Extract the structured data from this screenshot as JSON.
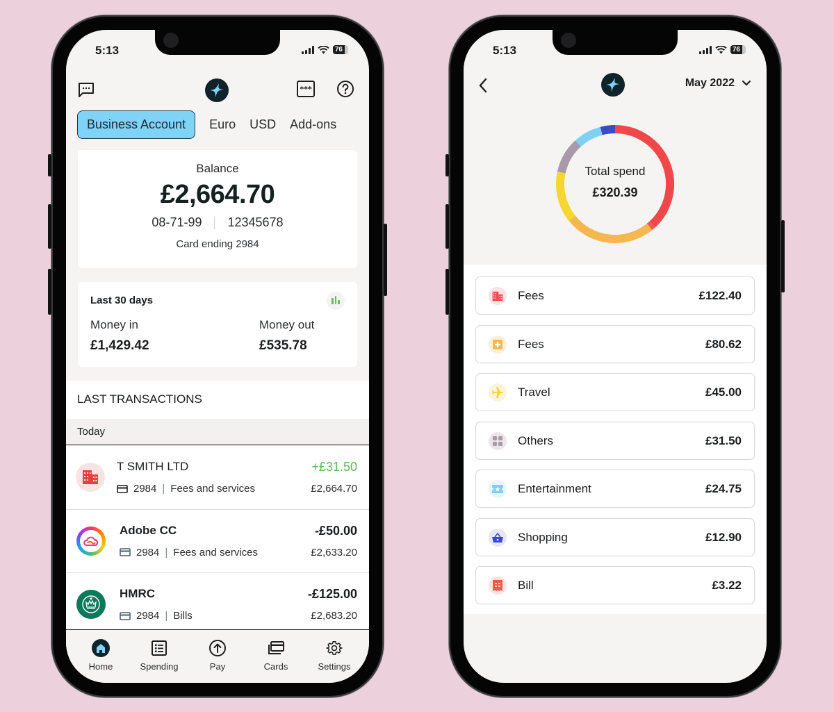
{
  "status_bar": {
    "time": "5:13",
    "battery": "76"
  },
  "home": {
    "tabs": [
      {
        "label": "Business Account",
        "active": true
      },
      {
        "label": "Euro",
        "active": false
      },
      {
        "label": "USD",
        "active": false
      },
      {
        "label": "Add-ons",
        "active": false
      }
    ],
    "balance": {
      "label": "Balance",
      "amount": "£2,664.70",
      "sort_code": "08-71-99",
      "account_number": "12345678",
      "card_ending": "Card ending 2984"
    },
    "period": {
      "title": "Last 30 days",
      "money_in_label": "Money in",
      "money_in": "£1,429.42",
      "money_out_label": "Money out",
      "money_out": "£535.78"
    },
    "transactions_header": "LAST TRANSACTIONS",
    "day_label": "Today",
    "transactions": [
      {
        "name": "T SMITH LTD",
        "card": "2984",
        "category": "Fees and services",
        "amount": "+£31.50",
        "balance": "£2,664.70",
        "icon": "building-icon",
        "positive": true
      },
      {
        "name": "Adobe CC",
        "card": "2984",
        "category": "Fees and services",
        "amount": "-£50.00",
        "balance": "£2,633.20",
        "icon": "adobe-cc-logo",
        "positive": false
      },
      {
        "name": "HMRC",
        "card": "2984",
        "category": "Bills",
        "amount": "-£125.00",
        "balance": "£2,683.20",
        "icon": "hmrc-crown-logo",
        "positive": false
      }
    ],
    "nav": [
      {
        "label": "Home",
        "icon": "home-icon",
        "active": true
      },
      {
        "label": "Spending",
        "icon": "list-icon",
        "active": false
      },
      {
        "label": "Pay",
        "icon": "arrow-up-circle-icon",
        "active": false
      },
      {
        "label": "Cards",
        "icon": "cards-icon",
        "active": false
      },
      {
        "label": "Settings",
        "icon": "gear-icon",
        "active": false
      }
    ]
  },
  "spending": {
    "month": "May 2022",
    "total_label": "Total spend",
    "total": "£320.39",
    "categories": [
      {
        "name": "Fees",
        "amount": "£122.40",
        "icon": "building-icon",
        "color": "#f0474b",
        "bg": "#fbe3e3"
      },
      {
        "name": "Fees",
        "amount": "£80.62",
        "icon": "medical-plus-icon",
        "color": "#f5b84e",
        "bg": "#fdf0d9"
      },
      {
        "name": "Travel",
        "amount": "£45.00",
        "icon": "plane-icon",
        "color": "#f8d631",
        "bg": "#fbf3da"
      },
      {
        "name": "Others",
        "amount": "£31.50",
        "icon": "grid-icon",
        "color": "#a89aa8",
        "bg": "#ece6ec"
      },
      {
        "name": "Entertainment",
        "amount": "£24.75",
        "icon": "ticket-icon",
        "color": "#7fd0f5",
        "bg": "#e6f6fd"
      },
      {
        "name": "Shopping",
        "amount": "£12.90",
        "icon": "basket-icon",
        "color": "#3b4bc4",
        "bg": "#e5e7f7"
      },
      {
        "name": "Bill",
        "amount": "£3.22",
        "icon": "receipt-icon",
        "color": "#ef5a50",
        "bg": "#fbe3e1"
      }
    ]
  },
  "chart_data": {
    "type": "pie",
    "title": "Total spend",
    "total": 320.39,
    "categories": [
      "Fees",
      "Fees",
      "Travel",
      "Others",
      "Entertainment",
      "Shopping",
      "Bill"
    ],
    "values": [
      122.4,
      80.62,
      45.0,
      31.5,
      24.75,
      12.9,
      3.22
    ],
    "colors": [
      "#f0474b",
      "#f5b84e",
      "#f8d631",
      "#a89aa8",
      "#7fd0f5",
      "#3b4bc4",
      "#ef5a50"
    ],
    "donut": true
  }
}
